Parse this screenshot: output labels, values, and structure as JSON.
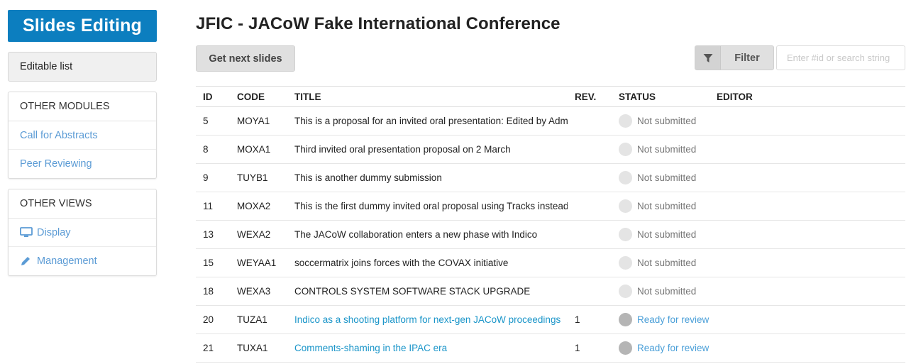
{
  "sidebar": {
    "module_title": "Slides Editing",
    "editable_list_label": "Editable list",
    "other_modules": {
      "header": "OTHER MODULES",
      "items": [
        {
          "label": "Call for Abstracts"
        },
        {
          "label": "Peer Reviewing"
        }
      ]
    },
    "other_views": {
      "header": "OTHER VIEWS",
      "items": [
        {
          "label": "Display",
          "icon": "monitor-icon"
        },
        {
          "label": "Management",
          "icon": "pencil-icon"
        }
      ]
    }
  },
  "main": {
    "title": "JFIC - JACoW Fake International Conference",
    "get_next_label": "Get next slides",
    "filter_label": "Filter",
    "search_placeholder": "Enter #id or search string",
    "columns": [
      "ID",
      "CODE",
      "TITLE",
      "REV.",
      "STATUS",
      "EDITOR"
    ],
    "rows": [
      {
        "id": "5",
        "code": "MOYA1",
        "title": "This is a proposal for an invited oral presentation: Edited by Adm",
        "rev": "",
        "status": "Not submitted",
        "editor": "",
        "link": false
      },
      {
        "id": "8",
        "code": "MOXA1",
        "title": "Third invited oral presentation proposal on 2 March",
        "rev": "",
        "status": "Not submitted",
        "editor": "",
        "link": false
      },
      {
        "id": "9",
        "code": "TUYB1",
        "title": "This is another dummy submission",
        "rev": "",
        "status": "Not submitted",
        "editor": "",
        "link": false
      },
      {
        "id": "11",
        "code": "MOXA2",
        "title": "This is the first dummy invited oral proposal using Tracks instead",
        "rev": "",
        "status": "Not submitted",
        "editor": "",
        "link": false
      },
      {
        "id": "13",
        "code": "WEXA2",
        "title": "The JACoW collaboration enters a new phase with Indico",
        "rev": "",
        "status": "Not submitted",
        "editor": "",
        "link": false
      },
      {
        "id": "15",
        "code": "WEYAA1",
        "title": "soccermatrix joins forces with the COVAX initiative",
        "rev": "",
        "status": "Not submitted",
        "editor": "",
        "link": false
      },
      {
        "id": "18",
        "code": "WEXA3",
        "title": "CONTROLS SYSTEM SOFTWARE STACK UPGRADE",
        "rev": "",
        "status": "Not submitted",
        "editor": "",
        "link": false
      },
      {
        "id": "20",
        "code": "TUZA1",
        "title": "Indico as a shooting platform for next-gen JACoW proceedings",
        "rev": "1",
        "status": "Ready for review",
        "editor": "",
        "link": true
      },
      {
        "id": "21",
        "code": "TUXA1",
        "title": "Comments-shaming in the IPAC era",
        "rev": "1",
        "status": "Ready for review",
        "editor": "",
        "link": true
      }
    ]
  },
  "colors": {
    "brand": "#0c7ebf",
    "link": "#1a95c9",
    "sidebar_link": "#5b9bd5",
    "ready": "#4a9fd8"
  }
}
